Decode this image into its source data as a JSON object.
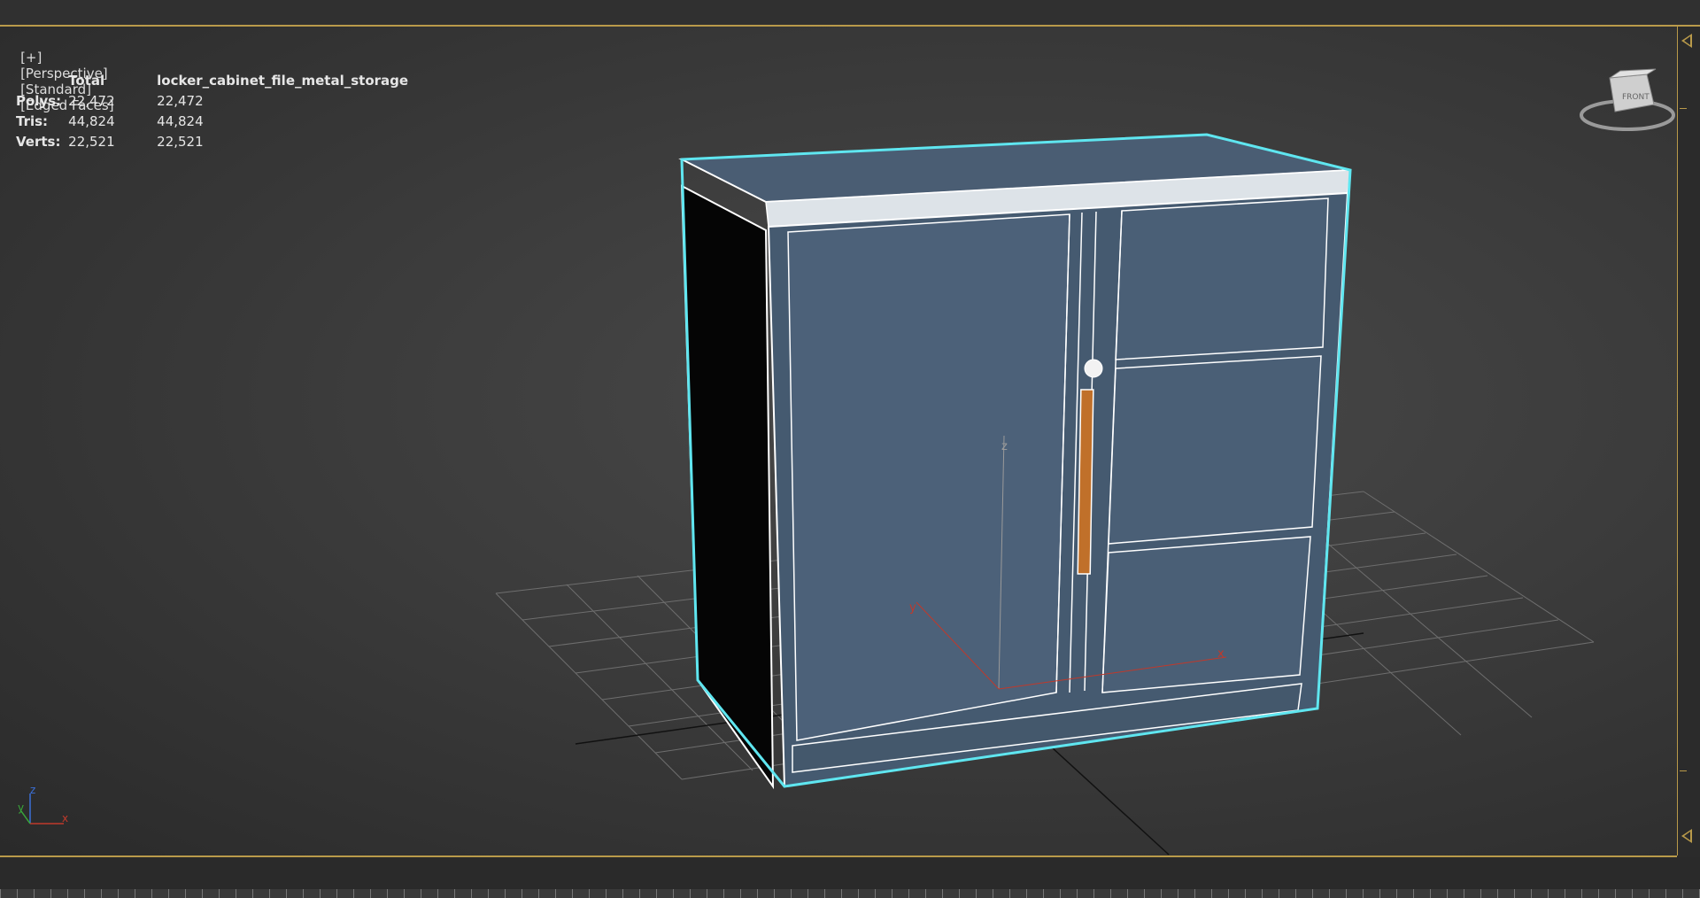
{
  "viewport": {
    "label_parts": [
      "[+]",
      "[Perspective]",
      "[Standard]",
      "[Edged Faces]"
    ]
  },
  "stats": {
    "header_total": "Total",
    "header_object": "locker_cabinet_file_metal_storage",
    "rows": [
      {
        "label": "Polys:",
        "total": "22,472",
        "object": "22,472"
      },
      {
        "label": "Tris:",
        "total": "44,824",
        "object": "44,824"
      },
      {
        "label": "Verts:",
        "total": "22,521",
        "object": "22,521"
      }
    ]
  },
  "viewcube": {
    "face_label": "FRONT"
  },
  "axis_labels": {
    "x": "x",
    "y": "y",
    "z": "z"
  },
  "colors": {
    "selection": "#5fe6f0",
    "cabinet_face": "#46596f",
    "handle": "#c0702a",
    "frame": "#b99a4a"
  }
}
